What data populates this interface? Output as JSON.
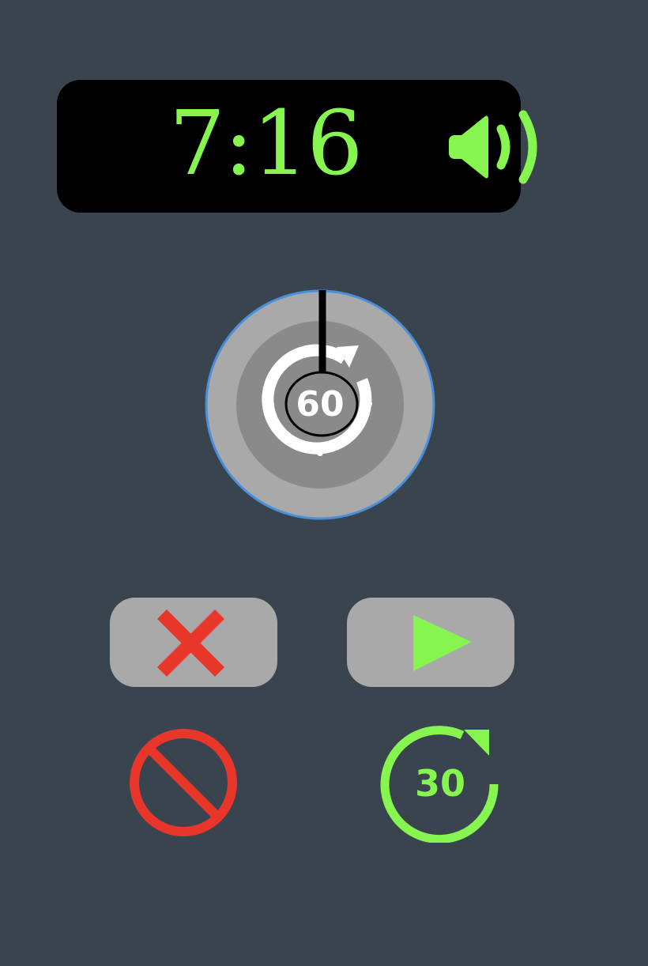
{
  "display": {
    "time": "7:16",
    "speaker_icon": "speaker-volume-icon"
  },
  "dial": {
    "label": "60",
    "icon": "replay-60-icon",
    "hand_icon": "dial-hand"
  },
  "controls": {
    "cancel_icon": "close-x-icon",
    "play_icon": "play-icon",
    "block_icon": "prohibited-icon",
    "replay_label": "30",
    "replay_icon": "replay-30-icon"
  },
  "colors": {
    "background": "#39444f",
    "display_bg": "#000000",
    "accent_green": "#86f54f",
    "accent_red": "#e8362b",
    "button_gray": "#a9a9a9",
    "dial_outer": "#a9a9a9",
    "dial_inner": "#8a8a8a",
    "dial_ring": "#4a8fdb"
  }
}
